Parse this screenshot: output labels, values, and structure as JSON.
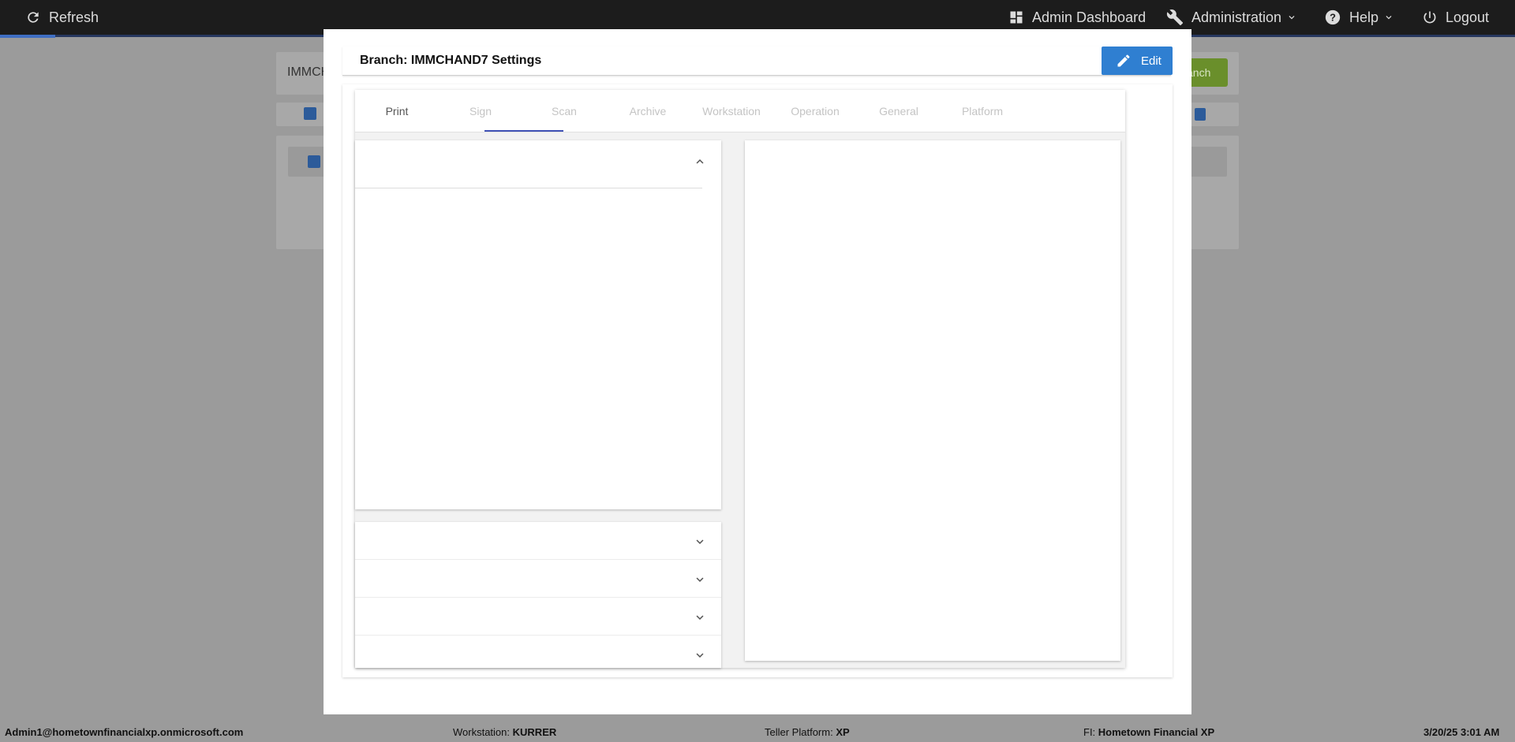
{
  "topbar": {
    "refresh": "Refresh",
    "admin_dashboard": "Admin Dashboard",
    "administration": "Administration",
    "help": "Help",
    "logout": "Logout"
  },
  "background": {
    "search_value": "IMMCH",
    "add_button_partial": "anch"
  },
  "modal": {
    "title": "Branch: IMMCHAND7 Settings",
    "edit_label": "Edit",
    "tabs": [
      "Print",
      "Sign",
      "Scan",
      "Archive",
      "Workstation",
      "Operation",
      "General",
      "Platform"
    ],
    "active_tab": "Scan"
  },
  "statusbar": {
    "user": "Admin1@hometownfinancialxp.onmicrosoft.com",
    "workstation_label": "Workstation:",
    "workstation_value": "KURRER",
    "platform_label": "Teller Platform:",
    "platform_value": "XP",
    "fi_label": "FI:",
    "fi_value": "Hometown Financial XP",
    "datetime": "3/20/25 3:01 AM"
  },
  "colors": {
    "accent_blue": "#2f7fd1",
    "tab_indicator": "#3f51b5",
    "topbar_bg": "#1c1c1c"
  }
}
